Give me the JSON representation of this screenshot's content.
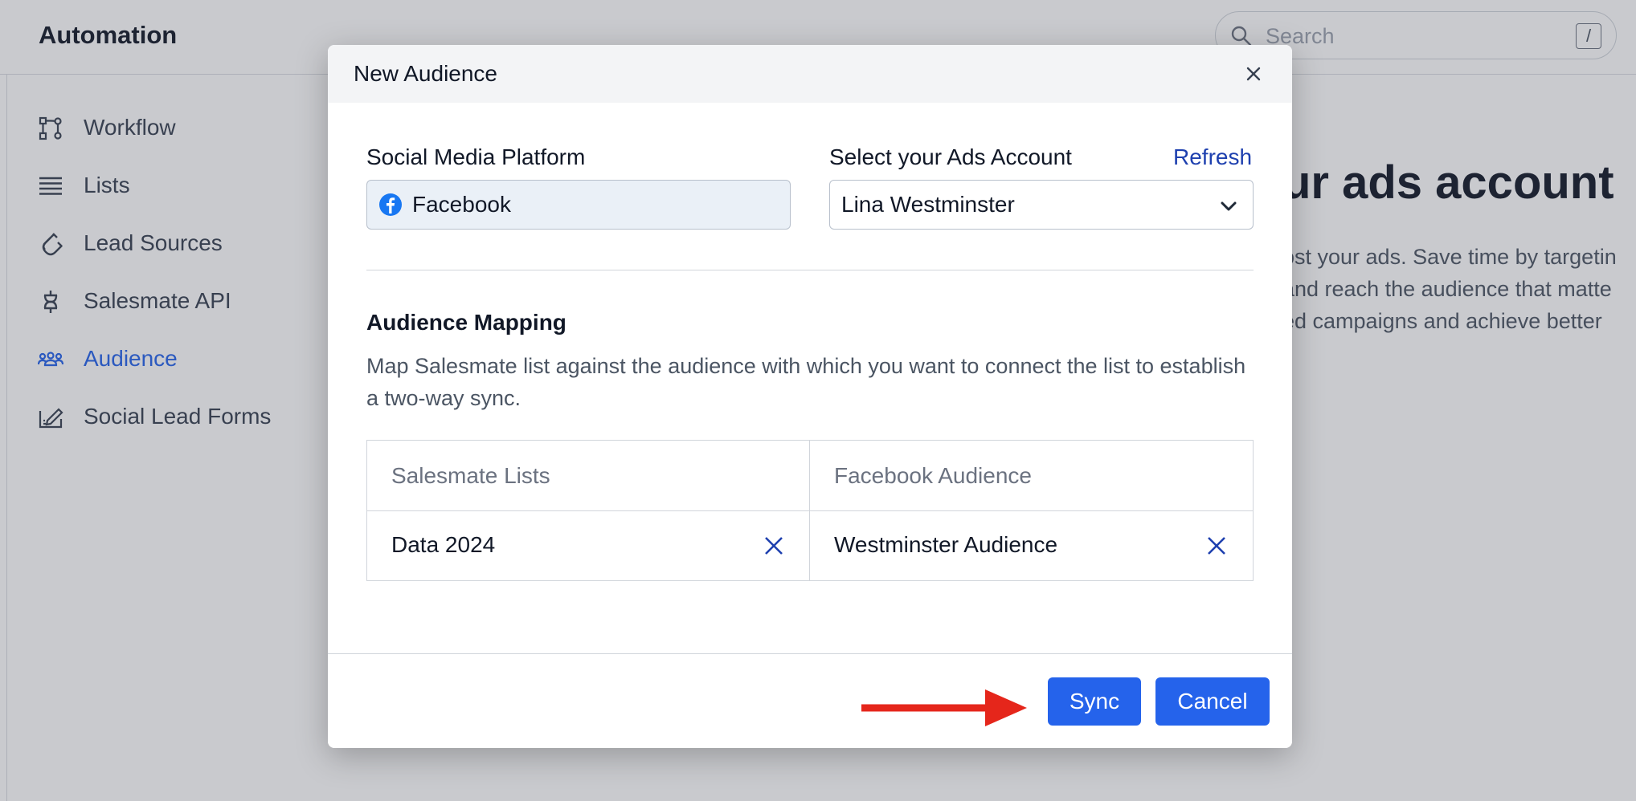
{
  "app": {
    "title": "Automation",
    "search_placeholder": "Search",
    "search_shortcut": "/"
  },
  "sidebar": {
    "items": [
      {
        "label": "Workflow",
        "icon": "workflow-icon",
        "active": false
      },
      {
        "label": "Lists",
        "icon": "list-icon",
        "active": false
      },
      {
        "label": "Lead Sources",
        "icon": "magnet-icon",
        "active": false
      },
      {
        "label": "Salesmate API",
        "icon": "api-icon",
        "active": false
      },
      {
        "label": "Audience",
        "icon": "audience-icon",
        "active": true
      },
      {
        "label": "Social Lead Forms",
        "icon": "form-icon",
        "active": false
      }
    ]
  },
  "background": {
    "heading": "ur ads account",
    "paragraph_lines": [
      "ost your ads. Save time by targetin",
      "and reach the audience that matte",
      "ed campaigns and achieve better"
    ]
  },
  "modal": {
    "title": "New Audience",
    "platform_label": "Social Media Platform",
    "platform_value": "Facebook",
    "ads_account_label": "Select your Ads Account",
    "refresh_label": "Refresh",
    "ads_account_value": "Lina Westminster",
    "section_title": "Audience Mapping",
    "section_description": "Map Salesmate list against the audience with which you want to connect the list to establish a two-way sync.",
    "table": {
      "headers": [
        "Salesmate Lists",
        "Facebook Audience"
      ],
      "row": [
        "Data 2024",
        "Westminster Audience"
      ]
    },
    "sync_label": "Sync",
    "cancel_label": "Cancel"
  },
  "colors": {
    "accent": "#2563eb",
    "link": "#1e40af",
    "arrow": "#e5261b",
    "facebook": "#1877f2"
  }
}
